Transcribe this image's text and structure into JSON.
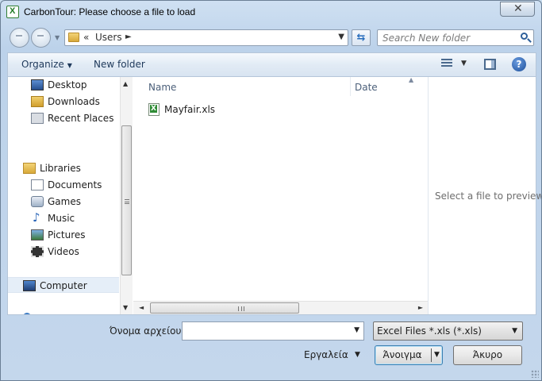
{
  "window": {
    "title": "CarbonTour: Please choose a file to load",
    "close_glyph": "✕",
    "app_icon": "excel-app-icon"
  },
  "address_bar": {
    "separator": "«",
    "crumb": "Users",
    "arrow": "►",
    "dropdown": "▼"
  },
  "search": {
    "placeholder": "Search New folder",
    "icon": "search-icon"
  },
  "toolbar": {
    "organize": "Organize",
    "new_folder": "New folder",
    "help_glyph": "?"
  },
  "navigation": {
    "items": [
      {
        "label": "Desktop",
        "icon": "desktop-icon"
      },
      {
        "label": "Downloads",
        "icon": "downloads-icon"
      },
      {
        "label": "Recent Places",
        "icon": "recent-places-icon"
      },
      {
        "label": "Libraries",
        "icon": "libraries-icon"
      },
      {
        "label": "Documents",
        "icon": "documents-icon"
      },
      {
        "label": "Games",
        "icon": "games-icon"
      },
      {
        "label": "Music",
        "icon": "music-icon"
      },
      {
        "label": "Pictures",
        "icon": "pictures-icon"
      },
      {
        "label": "Videos",
        "icon": "videos-icon"
      },
      {
        "label": "Computer",
        "icon": "computer-icon"
      }
    ],
    "selected": "Computer"
  },
  "file_list": {
    "columns": [
      "Name",
      "Date"
    ],
    "files": [
      {
        "name": "Mayfair.xls",
        "icon": "excel-file-icon"
      }
    ]
  },
  "preview": {
    "text": "Select a file to preview."
  },
  "bottom": {
    "filename_label": "Όνομα αρχείου:",
    "filename_value": "",
    "filter": "Excel Files *.xls (*.xls)",
    "tools": "Εργαλεία",
    "open": "Άνοιγμα",
    "cancel": "Άκυρο"
  },
  "colors": {
    "accent": "#2a6ebd",
    "selection": "#e5eef8",
    "frame": "#c9ddef"
  }
}
